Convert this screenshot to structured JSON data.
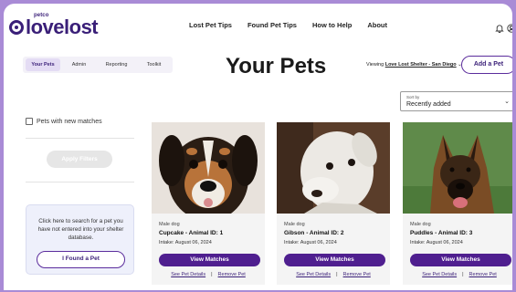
{
  "header": {
    "logo_small": "petco",
    "logo_text": "lovelost",
    "nav": [
      "Lost Pet Tips",
      "Found Pet Tips",
      "How to Help",
      "About"
    ]
  },
  "tabs": [
    {
      "label": "Your Pets",
      "active": true
    },
    {
      "label": "Admin",
      "active": false
    },
    {
      "label": "Reporting",
      "active": false
    },
    {
      "label": "Toolkit",
      "active": false
    }
  ],
  "page_title": "Your Pets",
  "viewing": {
    "prefix": "Viewing",
    "shelter": "Love Lost Shelter - San Diego",
    "chevron": "⌄"
  },
  "add_pet_label": "Add a Pet",
  "sort": {
    "label": "Sort by",
    "value": "Recently added",
    "chevron": "⌄"
  },
  "filters": {
    "checkbox_label": "Pets with new matches",
    "apply_label": "Apply Filters"
  },
  "search_box": {
    "text": "Click here to search for a pet you have not entered into your shelter database.",
    "button_label": "I Found a Pet"
  },
  "pets": [
    {
      "kind": "Male dog",
      "name": "Cupcake - Animal ID: 1",
      "intake": "Intake: August 06, 2024",
      "view_label": "View Matches",
      "details_label": "See Pet Details",
      "remove_label": "Remove Pet",
      "sep": "|"
    },
    {
      "kind": "Male dog",
      "name": "Gibson - Animal ID: 2",
      "intake": "Intake: August 06, 2024",
      "view_label": "View Matches",
      "details_label": "See Pet Details",
      "remove_label": "Remove Pet",
      "sep": "|"
    },
    {
      "kind": "Male dog",
      "name": "Puddles - Animal ID: 3",
      "intake": "Intake: August 06, 2024",
      "view_label": "View Matches",
      "details_label": "See Pet Details",
      "remove_label": "Remove Pet",
      "sep": "|"
    }
  ],
  "colors": {
    "brand": "#3a1f78",
    "primary_button": "#4f1f8f",
    "frame": "#a98bd6"
  },
  "icons": {
    "notification": "bell-icon",
    "account": "user-icon"
  }
}
